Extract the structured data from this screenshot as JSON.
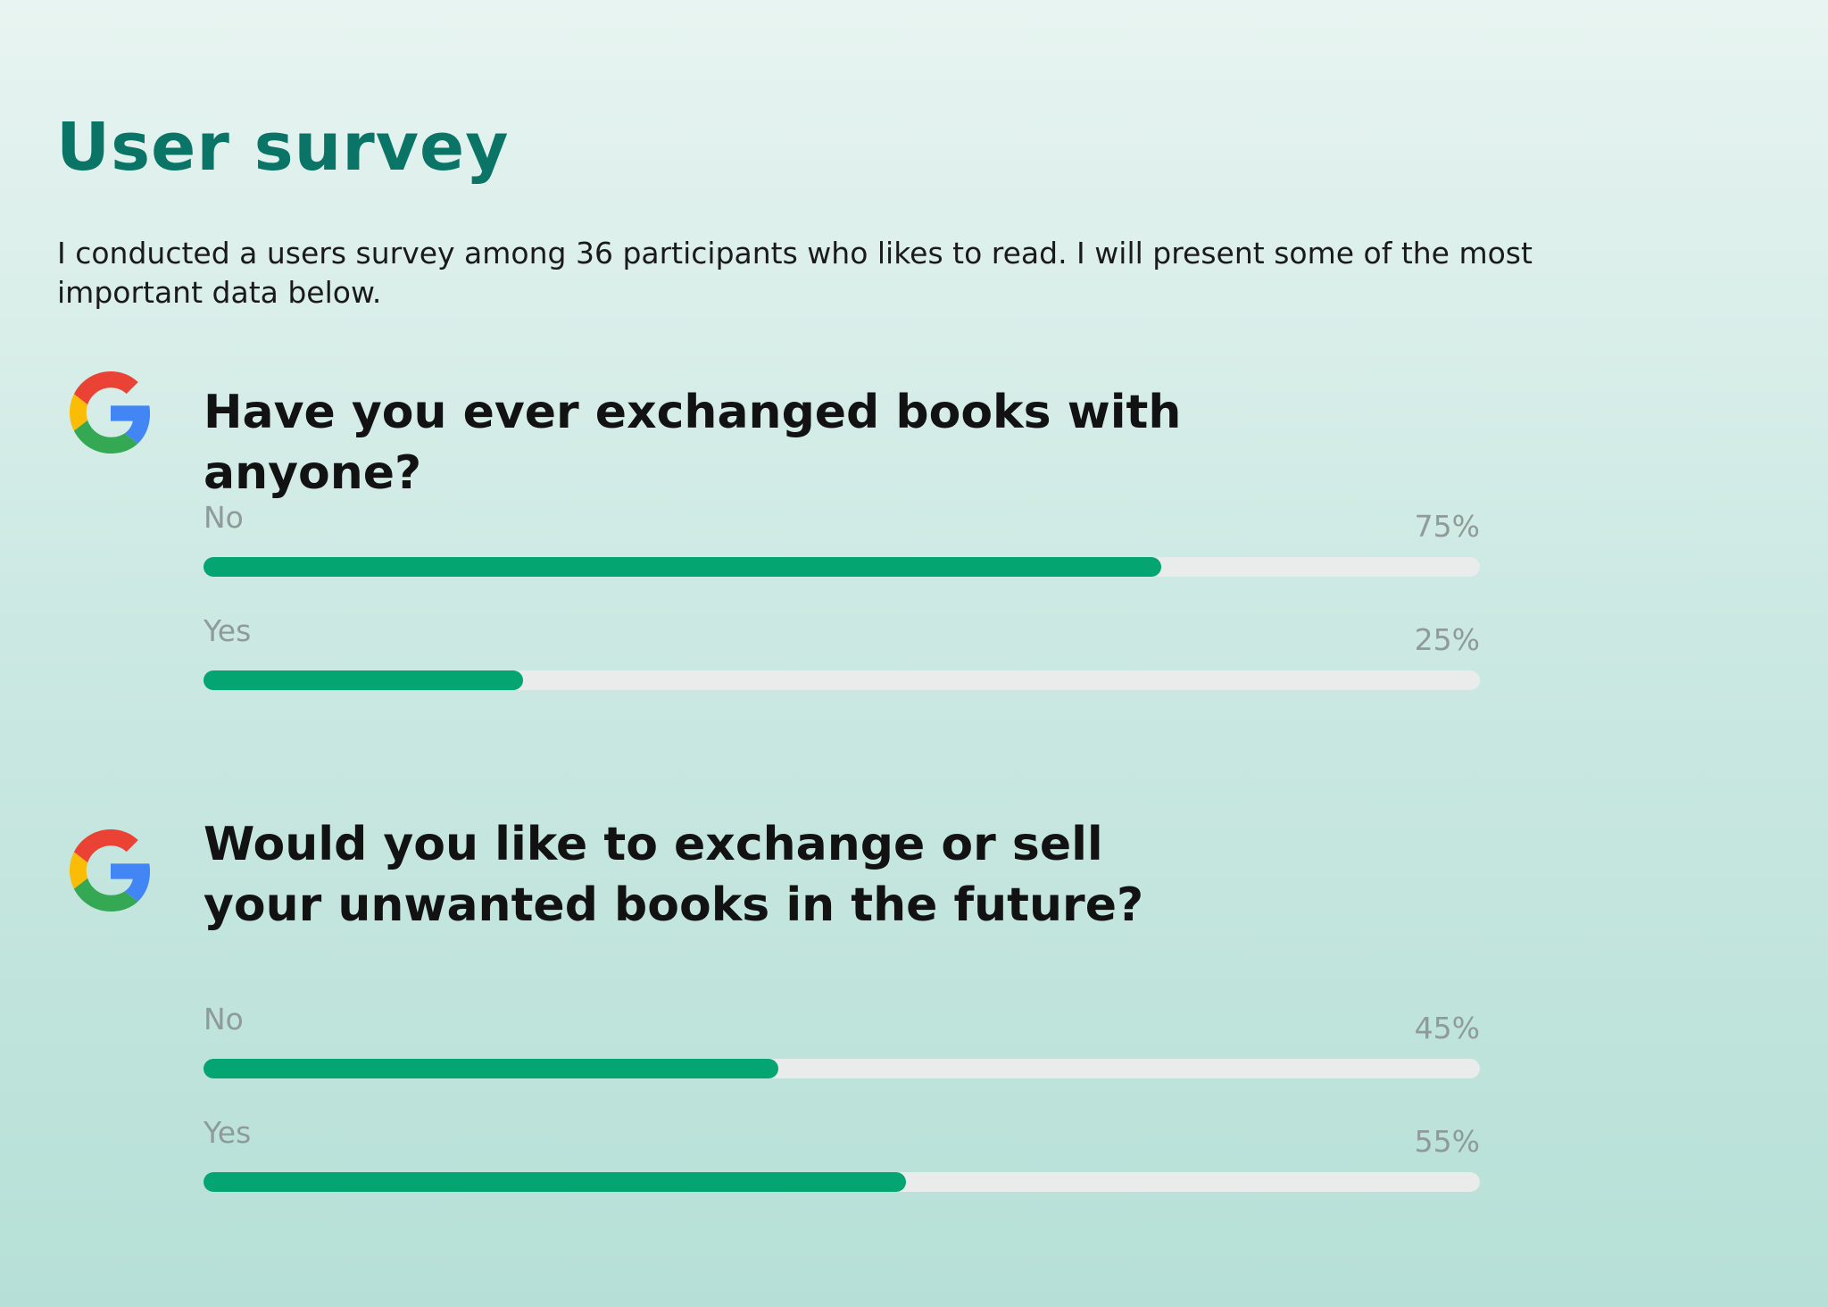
{
  "header": {
    "title": "User survey",
    "intro": "I conducted a users survey among 36 participants who likes to read. I will present some of the most important data below."
  },
  "colors": {
    "title": "#0a7566",
    "bar_fill": "#05a572",
    "bar_track": "#eaeceb",
    "label": "#8f9b98"
  },
  "questions": [
    {
      "icon": "google-icon",
      "title": "Have you ever exchanged books with anyone?",
      "options": [
        {
          "label": "No",
          "percent_text": "75%"
        },
        {
          "label": "Yes",
          "percent_text": "25%"
        }
      ]
    },
    {
      "icon": "google-icon",
      "title": "Would you like to exchange or sell your unwanted books in the future?",
      "options": [
        {
          "label": "No",
          "percent_text": "45%"
        },
        {
          "label": "Yes",
          "percent_text": "55%"
        }
      ]
    }
  ],
  "chart_data": [
    {
      "type": "bar",
      "orientation": "horizontal",
      "title": "Have you ever exchanged books with anyone?",
      "categories": [
        "No",
        "Yes"
      ],
      "values": [
        75,
        25
      ],
      "unit": "%",
      "xlim": [
        0,
        100
      ]
    },
    {
      "type": "bar",
      "orientation": "horizontal",
      "title": "Would you like to exchange or sell your unwanted books in the future?",
      "categories": [
        "No",
        "Yes"
      ],
      "values": [
        45,
        55
      ],
      "unit": "%",
      "xlim": [
        0,
        100
      ]
    }
  ]
}
